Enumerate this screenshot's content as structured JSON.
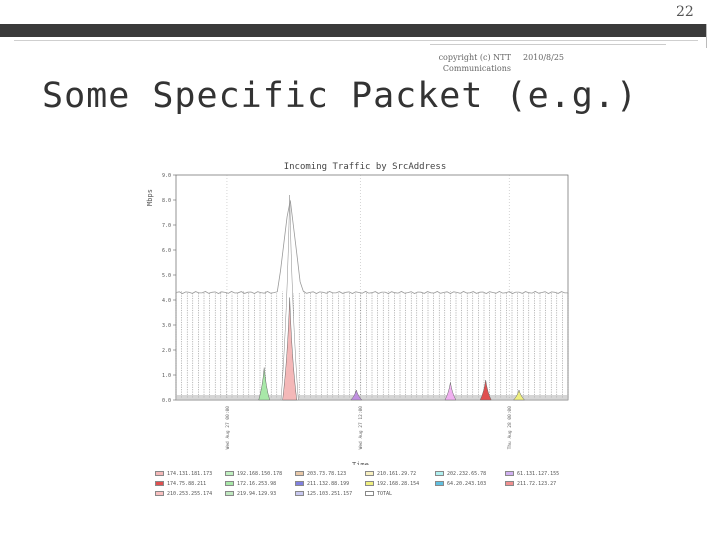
{
  "slide": {
    "number": "22",
    "copyright": "copyright (c) NTT Communications",
    "date": "2010/8/25",
    "title": "Some Specific Packet (e.g.)"
  },
  "chart_data": {
    "type": "area",
    "title": "Incoming Traffic by SrcAddress",
    "xlabel": "Time",
    "ylabel": "Mbps",
    "ylim": [
      0,
      9
    ],
    "yticks": [
      "0.0",
      "1.0",
      "2.0",
      "3.0",
      "4.0",
      "5.0",
      "6.0",
      "7.0",
      "8.0",
      "9.0"
    ],
    "day_markers": [
      "Wed Aug 27 00:00",
      "Wed Aug 27 12:00",
      "Thu Aug 28 00:00"
    ],
    "series": [
      {
        "name": "TOTAL",
        "color": "#ffffff",
        "peak_x": 0.29,
        "peak_y": 8.2,
        "baseline": 4.3
      },
      {
        "name": "174.131.181.173",
        "color": "#f4b8b8",
        "peak_x": 0.29,
        "peak_y": 4.1
      },
      {
        "name": "172.16.253.98",
        "color": "#a8e8a8",
        "peak_x": 0.225,
        "peak_y": 1.3
      },
      {
        "name": "192.168.28.154",
        "color": "#c090e0",
        "peak_x": 0.46,
        "peak_y": 0.4
      },
      {
        "name": "10.62.71.29",
        "color": "#f0b0f0",
        "peak_x": 0.7,
        "peak_y": 0.7
      },
      {
        "name": "202.232.13.8",
        "color": "#e05050",
        "peak_x": 0.79,
        "peak_y": 0.8
      },
      {
        "name": "210.142.6.55",
        "color": "#f0f080",
        "peak_x": 0.875,
        "peak_y": 0.4
      }
    ],
    "legend": [
      {
        "label": "174.131.181.173",
        "color": "#f4b8b8"
      },
      {
        "label": "192.168.150.178",
        "color": "#c0f0c0"
      },
      {
        "label": "203.73.78.123",
        "color": "#e8c8a8"
      },
      {
        "label": "210.161.29.72",
        "color": "#f8f0c0"
      },
      {
        "label": "202.232.65.78",
        "color": "#b0f0f0"
      },
      {
        "label": "61.131.127.155",
        "color": "#d0b0f0"
      },
      {
        "label": "174.75.88.211",
        "color": "#e05050"
      },
      {
        "label": "172.16.253.98",
        "color": "#a8e8a8"
      },
      {
        "label": "211.132.88.199",
        "color": "#8080e0"
      },
      {
        "label": "192.168.28.154",
        "color": "#f0f080"
      },
      {
        "label": "64.20.243.103",
        "color": "#60c0e0"
      },
      {
        "label": "211.72.123.27",
        "color": "#f09090"
      },
      {
        "label": "210.253.255.174",
        "color": "#f8c0c0"
      },
      {
        "label": "219.94.129.93",
        "color": "#c0e8c0"
      },
      {
        "label": "125.103.251.157",
        "color": "#c8c8f0"
      },
      {
        "label": "TOTAL",
        "color": "#ffffff"
      }
    ]
  }
}
